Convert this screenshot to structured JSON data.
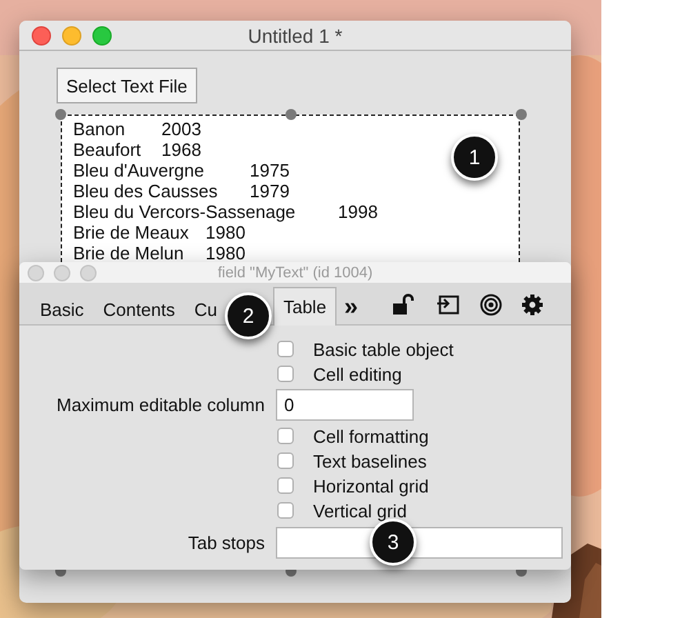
{
  "main_window": {
    "title": "Untitled 1 *",
    "button": "Select Text File",
    "text_field": {
      "lines": [
        "Banon\t2003",
        "Beaufort\t1968",
        "Bleu d'Auvergne\t1975",
        "Bleu des Causses\t1979",
        "Bleu du Vercors-Sassenage\t1998",
        "Brie de Meaux\t1980",
        "Brie de Melun\t1980"
      ]
    }
  },
  "inspector": {
    "title": "field \"MyText\" (id 1004)",
    "tabs": [
      {
        "label": "Basic",
        "selected": false
      },
      {
        "label": "Contents",
        "selected": false
      },
      {
        "label": "Cu",
        "selected": false
      },
      {
        "label": "Table",
        "selected": true
      }
    ],
    "more": "»",
    "rows": [
      {
        "kind": "checkbox",
        "label": "Basic table object",
        "checked": false
      },
      {
        "kind": "checkbox",
        "label": "Cell editing",
        "checked": false
      },
      {
        "kind": "field",
        "label": "Maximum editable column",
        "value": "0"
      },
      {
        "kind": "checkbox",
        "label": "Cell formatting",
        "checked": false
      },
      {
        "kind": "checkbox",
        "label": "Text baselines",
        "checked": false
      },
      {
        "kind": "checkbox",
        "label": "Horizontal grid",
        "checked": false
      },
      {
        "kind": "checkbox",
        "label": "Vertical grid",
        "checked": false
      },
      {
        "kind": "field",
        "label": "Tab stops"
      }
    ]
  },
  "callouts": [
    "1",
    "2",
    "3"
  ]
}
